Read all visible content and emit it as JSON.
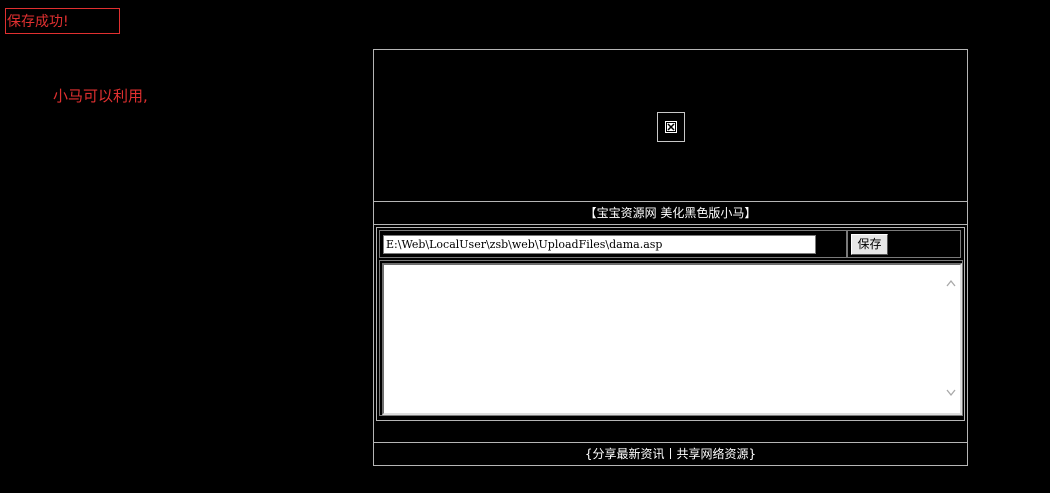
{
  "banner": {
    "status_text": "保存成功!"
  },
  "note": {
    "text": "小马可以利用,"
  },
  "panel": {
    "logo_icon": "broken-image-icon",
    "title": "【宝宝资源网 美化黑色版小马】",
    "path_value": "E:\\Web\\LocalUser\\zsb\\web\\UploadFiles\\dama.asp",
    "save_label": "保存",
    "content_value": "",
    "footer_text": "{分享最新资讯丨共享网络资源}"
  },
  "colors": {
    "background": "#000000",
    "alert_red": "#e03030",
    "border_gray": "#b5b5b5"
  }
}
